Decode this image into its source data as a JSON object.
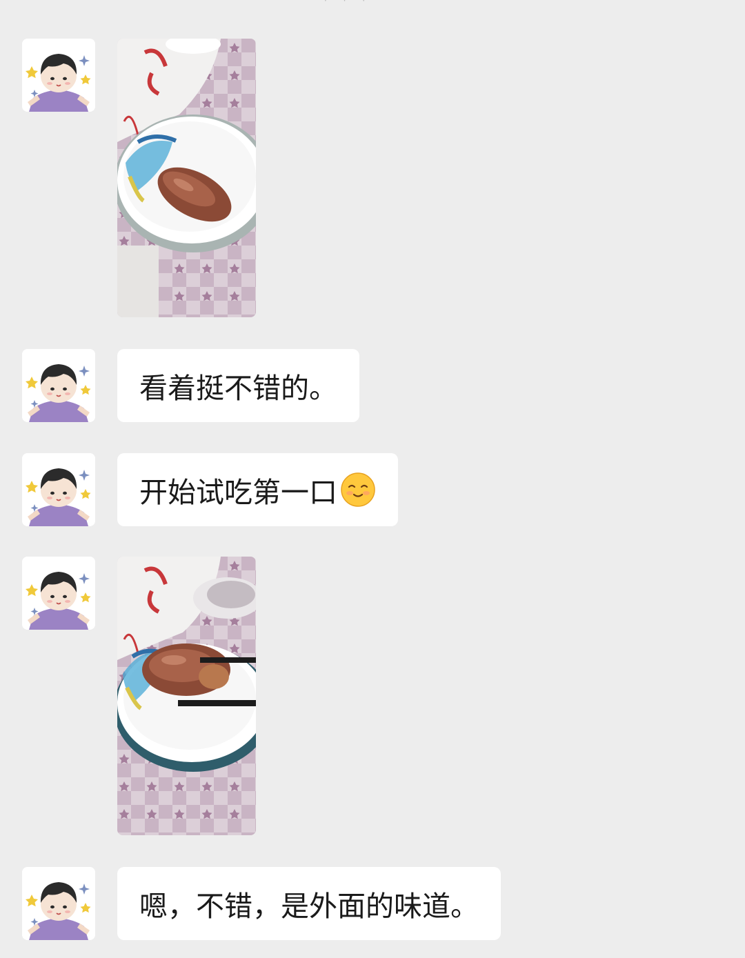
{
  "top_hint": "· · ·",
  "messages": [
    {
      "type": "image",
      "alt": "sausage-in-bowl"
    },
    {
      "type": "text",
      "text": "看着挺不错的。"
    },
    {
      "type": "text",
      "text": "开始试吃第一口",
      "emoji": "smiling-face-emoji"
    },
    {
      "type": "image",
      "alt": "sausage-with-chopsticks"
    },
    {
      "type": "text",
      "text": "嗯，不错，是外面的味道。"
    }
  ],
  "colors": {
    "background": "#ededed",
    "bubble": "#ffffff",
    "text": "#1a1a1a",
    "avatar_shirt": "#9b83c4"
  }
}
